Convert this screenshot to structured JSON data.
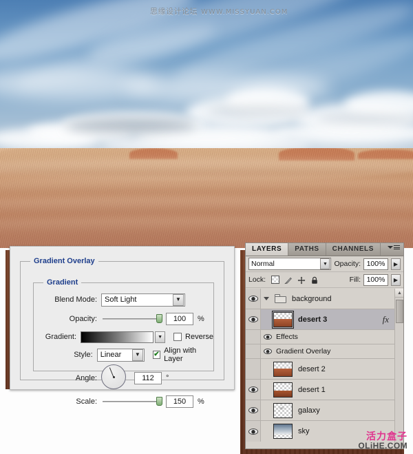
{
  "watermarks": {
    "top": "思缘设计论坛",
    "top_url": "WWW.MISSYUAN.COM",
    "bottom_cn": "活力盒子",
    "bottom_domain": "OLiHE.COM"
  },
  "canvas": {
    "description": "desert-and-sky-composite",
    "sky_color": "#8fb2d0",
    "sand_color": "#c8926a"
  },
  "dialog": {
    "section_title": "Gradient Overlay",
    "group_title": "Gradient",
    "fields": {
      "blend_mode_label": "Blend Mode:",
      "blend_mode_value": "Soft Light",
      "opacity_label": "Opacity:",
      "opacity_value": "100",
      "opacity_unit": "%",
      "gradient_label": "Gradient:",
      "gradient_preview_from": "#000000",
      "gradient_preview_to": "#ffffff",
      "reverse_label": "Reverse",
      "reverse_checked": "",
      "style_label": "Style:",
      "style_value": "Linear",
      "align_label": "Align with Layer",
      "align_checked": "✔",
      "angle_label": "Angle:",
      "angle_value": "112",
      "angle_unit": "°",
      "scale_label": "Scale:",
      "scale_value": "150",
      "scale_unit": "%"
    }
  },
  "layers_panel": {
    "tabs": [
      {
        "label": "LAYERS",
        "active": true
      },
      {
        "label": "PATHS",
        "active": false
      },
      {
        "label": "CHANNELS",
        "active": false
      }
    ],
    "menu_icon": "panel-menu-icon",
    "blend_mode": "Normal",
    "opacity_label": "Opacity:",
    "opacity_value": "100%",
    "lock_label": "Lock:",
    "lock_icons": [
      "lock-transparency-icon",
      "lock-image-icon",
      "lock-position-icon",
      "lock-all-icon"
    ],
    "fill_label": "Fill:",
    "fill_value": "100%",
    "rows": [
      {
        "name": "background",
        "kind": "group",
        "visible": true,
        "selected": false,
        "bold": false,
        "fx": false,
        "expanded": true
      },
      {
        "name": "desert 3",
        "kind": "layer",
        "visible": true,
        "selected": true,
        "bold": true,
        "fx": true,
        "thumb": "desert"
      },
      {
        "name": "Effects",
        "kind": "effects-header",
        "visible": true
      },
      {
        "name": "Gradient Overlay",
        "kind": "effect",
        "visible": true
      },
      {
        "name": "desert 2",
        "kind": "layer",
        "visible": false,
        "selected": false,
        "bold": false,
        "fx": false,
        "thumb": "desert"
      },
      {
        "name": "desert 1",
        "kind": "layer",
        "visible": true,
        "selected": false,
        "bold": false,
        "fx": false,
        "thumb": "desert2"
      },
      {
        "name": "galaxy",
        "kind": "layer",
        "visible": true,
        "selected": false,
        "bold": false,
        "fx": false,
        "thumb": "galaxy"
      },
      {
        "name": "sky",
        "kind": "layer",
        "visible": true,
        "selected": false,
        "bold": false,
        "fx": false,
        "thumb": "sky"
      }
    ]
  }
}
